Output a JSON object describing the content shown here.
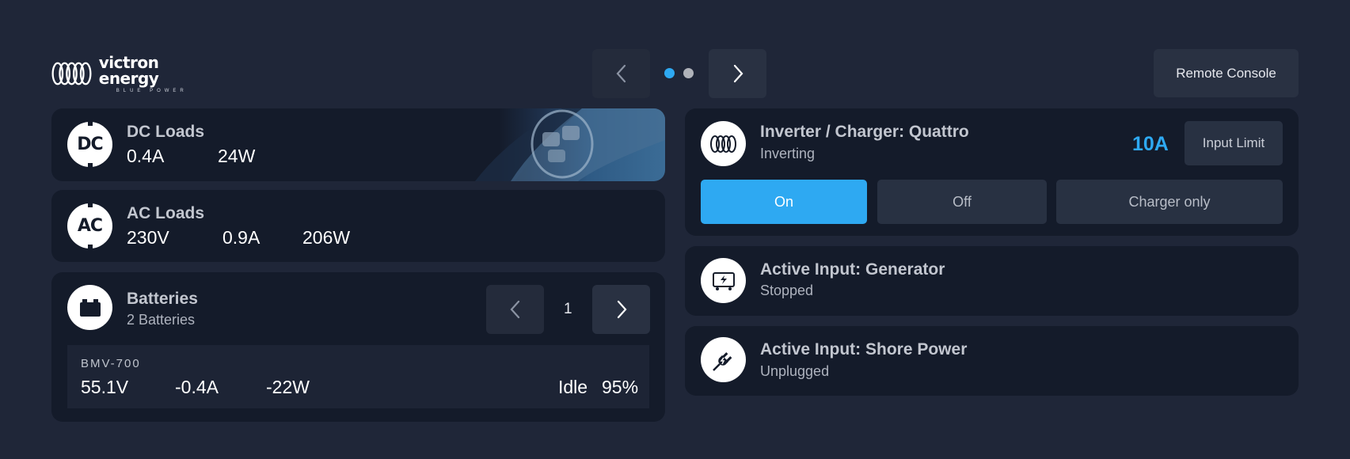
{
  "brand": {
    "name": "victron energy",
    "tagline": "BLUE POWER"
  },
  "pager": {
    "prev_icon": "chevron-left-icon",
    "next_icon": "chevron-right-icon",
    "pages": 2,
    "active_page": 1,
    "active_color": "#2ea9f2",
    "inactive_color": "#b0b3ba"
  },
  "header": {
    "remote_console_label": "Remote Console"
  },
  "dc_loads": {
    "icon_text": "DC",
    "title": "DC Loads",
    "current": "0.4A",
    "power": "24W"
  },
  "ac_loads": {
    "icon_text": "AC",
    "title": "AC Loads",
    "voltage": "230V",
    "current": "0.9A",
    "power": "206W"
  },
  "batteries": {
    "icon": "battery-icon",
    "title": "Batteries",
    "subtitle": "2 Batteries",
    "page": "1",
    "device": {
      "name": "BMV-700",
      "voltage": "55.1V",
      "current": "-0.4A",
      "power": "-22W",
      "state": "Idle",
      "soc": "95%"
    }
  },
  "inverter": {
    "icon": "victron-logo-icon",
    "title": "Inverter / Charger: Quattro",
    "status": "Inverting",
    "input_limit_value": "10A",
    "input_limit_label": "Input Limit",
    "modes": [
      {
        "label": "On",
        "active": true
      },
      {
        "label": "Off",
        "active": false
      },
      {
        "label": "Charger only",
        "active": false
      }
    ]
  },
  "generator": {
    "icon": "generator-icon",
    "title": "Active Input: Generator",
    "status": "Stopped"
  },
  "shore": {
    "icon": "plug-icon",
    "title": "Active Input: Shore Power",
    "status": "Unplugged"
  },
  "colors": {
    "background": "#1f2638",
    "card": "#141b2a",
    "accent": "#2ea9f2",
    "button": "#283142"
  }
}
